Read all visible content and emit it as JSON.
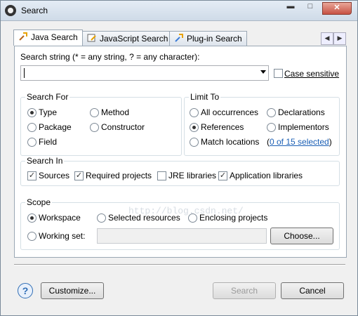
{
  "window": {
    "title": "Search"
  },
  "tabs": [
    {
      "label": "Java Search",
      "icon": "java-search-icon"
    },
    {
      "label": "JavaScript Search",
      "icon": "javascript-search-icon"
    },
    {
      "label": "Plug-in Search",
      "icon": "plugin-search-icon"
    }
  ],
  "search_string": {
    "label": "Search string (* = any string, ? = any character):",
    "value": "",
    "case_sensitive_label": "Case sensitive",
    "case_sensitive": false
  },
  "search_for": {
    "title": "Search For",
    "options": [
      "Type",
      "Method",
      "Package",
      "Constructor",
      "Field"
    ],
    "selected": "Type"
  },
  "limit_to": {
    "title": "Limit To",
    "options": [
      "All occurrences",
      "Declarations",
      "References",
      "Implementors",
      "Match locations"
    ],
    "selected": "References",
    "match_link": "0 of 15 selected"
  },
  "search_in": {
    "title": "Search In",
    "items": [
      {
        "label": "Sources",
        "checked": true
      },
      {
        "label": "Required projects",
        "checked": true
      },
      {
        "label": "JRE libraries",
        "checked": false
      },
      {
        "label": "Application libraries",
        "checked": true
      }
    ]
  },
  "scope": {
    "title": "Scope",
    "options": [
      "Workspace",
      "Selected resources",
      "Enclosing projects",
      "Working set:"
    ],
    "selected": "Workspace",
    "working_set_value": "",
    "choose_label": "Choose..."
  },
  "watermark": "http://blog.csdn.net/",
  "footer": {
    "customize_label": "Customize...",
    "search_label": "Search",
    "cancel_label": "Cancel",
    "help_symbol": "?"
  }
}
